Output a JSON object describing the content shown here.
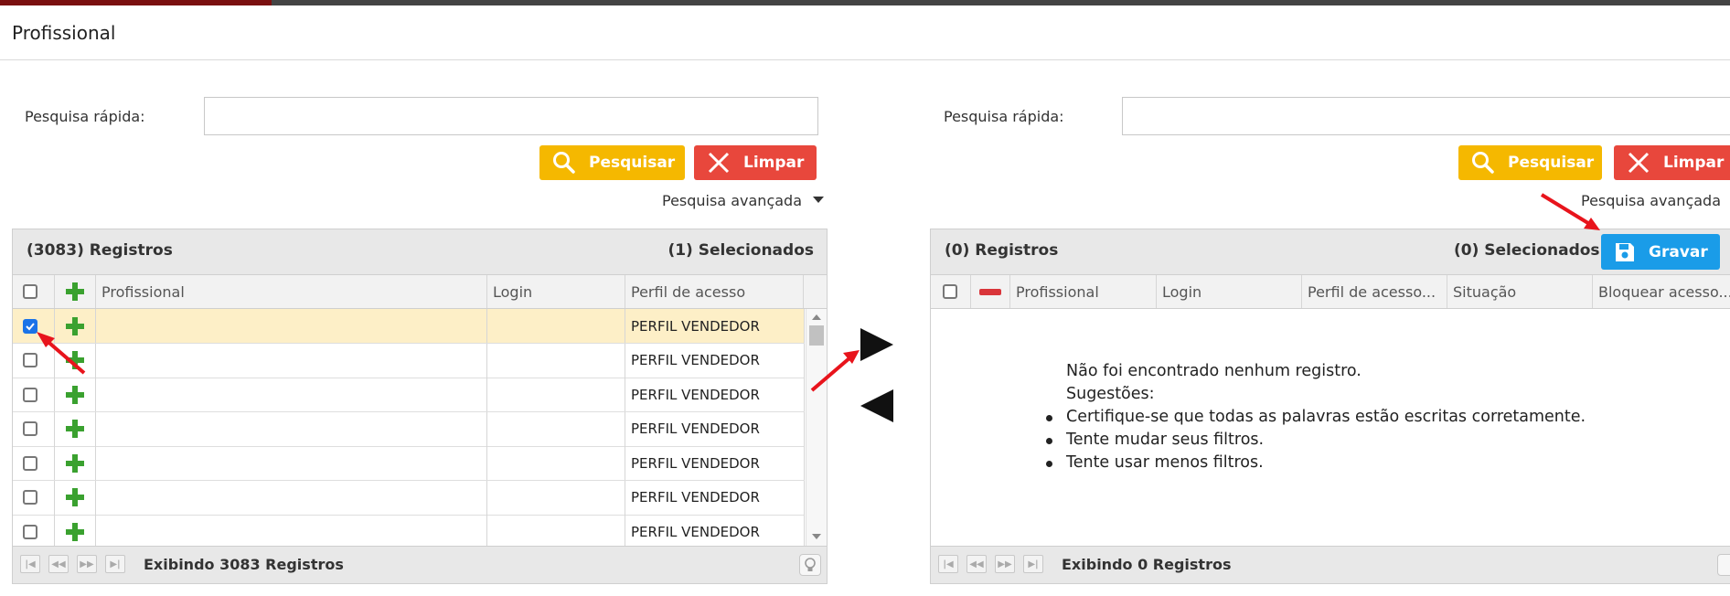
{
  "title": "Profissional",
  "left": {
    "search_label": "Pesquisa rápida:",
    "search_value": "",
    "search_button": "Pesquisar",
    "clear_button": "Limpar",
    "advanced": "Pesquisa avançada",
    "records": "(3083) Registros",
    "selected": "(1) Selecionados",
    "columns": [
      "Profissional",
      "Login",
      "Perfil de acesso"
    ],
    "rows": [
      {
        "checked": true,
        "profissional": "",
        "login": "",
        "perfil": "PERFIL VENDEDOR"
      },
      {
        "checked": false,
        "profissional": "",
        "login": "",
        "perfil": "PERFIL VENDEDOR"
      },
      {
        "checked": false,
        "profissional": "",
        "login": "",
        "perfil": "PERFIL VENDEDOR"
      },
      {
        "checked": false,
        "profissional": "",
        "login": "",
        "perfil": "PERFIL VENDEDOR"
      },
      {
        "checked": false,
        "profissional": "",
        "login": "",
        "perfil": "PERFIL VENDEDOR"
      },
      {
        "checked": false,
        "profissional": "",
        "login": "",
        "perfil": "PERFIL VENDEDOR"
      },
      {
        "checked": false,
        "profissional": "",
        "login": "",
        "perfil": "PERFIL VENDEDOR"
      }
    ],
    "footer": "Exibindo 3083 Registros"
  },
  "right": {
    "search_label": "Pesquisa rápida:",
    "search_value": "",
    "search_button": "Pesquisar",
    "clear_button": "Limpar",
    "advanced": "Pesquisa avançada",
    "records": "(0) Registros",
    "selected": "(0) Selecionados",
    "save_button": "Gravar",
    "columns": [
      "Profissional",
      "Login",
      "Perfil de acesso...",
      "Situação",
      "Bloquear acesso..."
    ],
    "empty_title": "Não foi encontrado nenhum registro.",
    "empty_suggestions": "Sugestões:",
    "empty_items": [
      "Certifique-se que todas as palavras estão escritas corretamente.",
      "Tente mudar seus filtros.",
      "Tente usar menos filtros."
    ],
    "footer": "Exibindo 0 Registros"
  },
  "colors": {
    "search_button": "#f5b800",
    "clear_button": "#e8473c",
    "save_button": "#1a9ce8",
    "selected_row": "#fdefc7",
    "annotation_arrow": "#e8141c"
  }
}
